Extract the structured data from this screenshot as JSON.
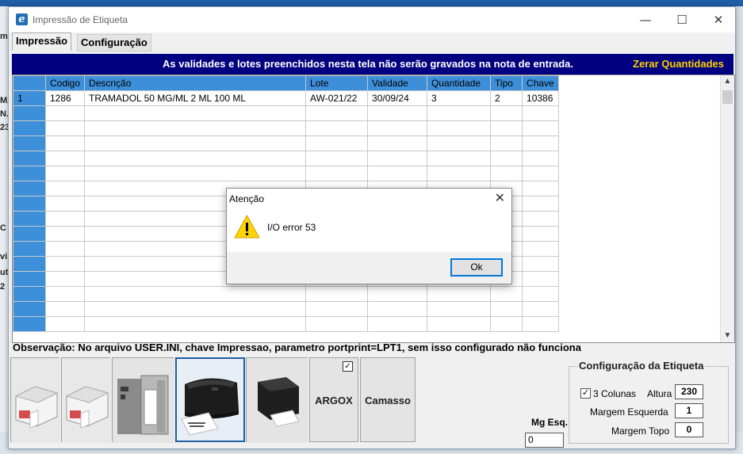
{
  "window": {
    "title": "Impressão de Etiqueta",
    "controls": [
      "—",
      "☐",
      "✕"
    ]
  },
  "tabs": [
    {
      "label": "Impressão",
      "active": true
    },
    {
      "label": "Configuração",
      "active": false
    }
  ],
  "banner": {
    "message": "As validades e lotes preenchidos nesta tela não serão gravados na nota de entrada.",
    "zerar_label": "Zerar Quantidades",
    "bg_color": "#000080",
    "zerar_color": "#ffd200"
  },
  "grid": {
    "columns": [
      "",
      "Codigo",
      "Descrição",
      "Lote",
      "Validade",
      "Quantidade",
      "Tipo",
      "Chave"
    ],
    "rows": [
      [
        "1",
        "1286",
        "TRAMADOL 50 MG/ML 2 ML 100 ML",
        "AW-021/22",
        "30/09/24",
        "3",
        "2",
        "10386"
      ]
    ],
    "empty_rows": 15,
    "header_color": "#3d8fd9"
  },
  "observacao": "Observação: No arquivo USER.INI, chave Impressao, parametro portprint=LPT1, sem isso configurado não funciona",
  "printers": [
    {
      "name": "zebra-lp-printer-1-icon",
      "label": "",
      "selected": false
    },
    {
      "name": "zebra-lp-printer-2-icon",
      "label": "",
      "selected": false
    },
    {
      "name": "zebra-industrial-printer-icon",
      "label": "",
      "selected": false
    },
    {
      "name": "zebra-desktop-printer-icon",
      "label": "",
      "selected": true
    },
    {
      "name": "argox-desktop-printer-icon",
      "label": "",
      "selected": false
    },
    {
      "name": "argox-button",
      "label": "ARGOX",
      "selected": false,
      "checked": true
    },
    {
      "name": "camasso-button",
      "label": "Camasso",
      "selected": false
    }
  ],
  "mg_esq": {
    "label": "Mg Esq.",
    "value": "0"
  },
  "config_etiqueta": {
    "legend": "Configuração da Etiqueta",
    "tres_colunas_label": "3 Colunas",
    "tres_colunas_checked": true,
    "altura_label": "Altura",
    "altura_value": "230",
    "margem_esquerda_label": "Margem Esquerda",
    "margem_esquerda_value": "1",
    "margem_topo_label": "Margem Topo",
    "margem_topo_value": "0"
  },
  "dialog": {
    "title": "Atenção",
    "message": "I/O error 53",
    "ok_label": "Ok",
    "icon": "warning-icon"
  },
  "background_app": {
    "fragments": [
      "m",
      "MA",
      "N.",
      "23",
      "C",
      "vi",
      "uti",
      "2"
    ]
  }
}
